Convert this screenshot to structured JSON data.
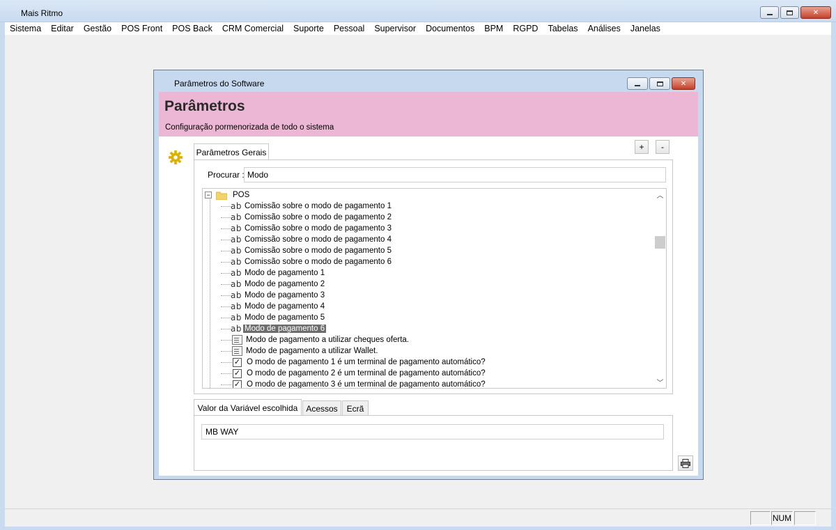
{
  "app": {
    "title": "Mais Ritmo"
  },
  "menu": [
    "Sistema",
    "Editar",
    "Gestão",
    "POS Front",
    "POS Back",
    "CRM Comercial",
    "Suporte",
    "Pessoal",
    "Supervisor",
    "Documentos",
    "BPM",
    "RGPD",
    "Tabelas",
    "Análises",
    "Janelas"
  ],
  "dialog": {
    "title": "Parâmetros do Software",
    "banner_title": "Parâmetros",
    "banner_subtitle": "Configuração pormenorizada de todo o sistema",
    "top_tab": "Parâmetros Gerais",
    "plus_label": "+",
    "minus_label": "-",
    "search_label": "Procurar :",
    "search_value": "Modo",
    "tree": {
      "root": "POS",
      "items": [
        {
          "icon": "ab",
          "label": "Comissão sobre o modo de pagamento 1",
          "selected": false
        },
        {
          "icon": "ab",
          "label": "Comissão sobre o modo de pagamento 2",
          "selected": false
        },
        {
          "icon": "ab",
          "label": "Comissão sobre o modo de pagamento 3",
          "selected": false
        },
        {
          "icon": "ab",
          "label": "Comissão sobre o modo de pagamento 4",
          "selected": false
        },
        {
          "icon": "ab",
          "label": "Comissão sobre o modo de pagamento 5",
          "selected": false
        },
        {
          "icon": "ab",
          "label": "Comissão sobre o modo de pagamento 6",
          "selected": false
        },
        {
          "icon": "ab",
          "label": "Modo de pagamento 1",
          "selected": false
        },
        {
          "icon": "ab",
          "label": "Modo de pagamento 2",
          "selected": false
        },
        {
          "icon": "ab",
          "label": "Modo de pagamento 3",
          "selected": false
        },
        {
          "icon": "ab",
          "label": "Modo de pagamento 4",
          "selected": false
        },
        {
          "icon": "ab",
          "label": "Modo de pagamento 5",
          "selected": false
        },
        {
          "icon": "ab",
          "label": "Modo de pagamento 6",
          "selected": true
        },
        {
          "icon": "doc",
          "label": "Modo de pagamento a utilizar cheques oferta.",
          "selected": false
        },
        {
          "icon": "doc",
          "label": "Modo de pagamento a utilizar Wallet.",
          "selected": false
        },
        {
          "icon": "check",
          "label": "O modo de pagamento 1 é um terminal de pagamento automático?",
          "selected": false
        },
        {
          "icon": "check",
          "label": "O modo de pagamento 2 é um terminal de pagamento automático?",
          "selected": false
        },
        {
          "icon": "check",
          "label": "O modo de pagamento 3 é um terminal de pagamento automático?",
          "selected": false
        }
      ]
    },
    "bottom_tabs": [
      "Valor da Variável escolhida",
      "Acessos",
      "Ecrã"
    ],
    "value": "MB WAY"
  },
  "status": {
    "num": "NUM"
  },
  "colors": {
    "banner": "#ebb7d5",
    "gear": "#e0b000",
    "selection": "#6d6d6d"
  }
}
